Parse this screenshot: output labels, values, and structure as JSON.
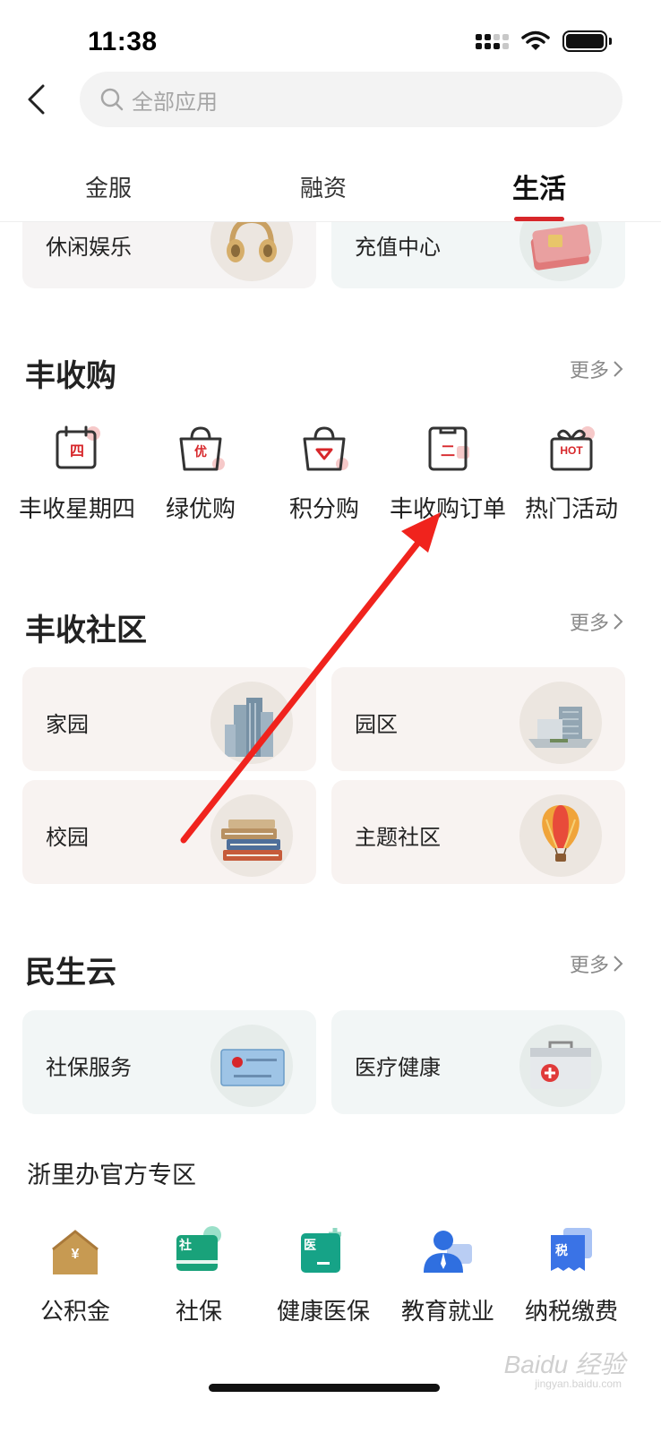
{
  "status_bar": {
    "time": "11:38"
  },
  "search": {
    "placeholder": "全部应用"
  },
  "tabs": [
    {
      "label": "金服",
      "active": false
    },
    {
      "label": "融资",
      "active": false
    },
    {
      "label": "生活",
      "active": true
    }
  ],
  "top_cards": [
    {
      "label": "休闲娱乐",
      "icon": "headphones-icon"
    },
    {
      "label": "充值中心",
      "icon": "sim-card-icon"
    }
  ],
  "fengshougou": {
    "title": "丰收购",
    "more": "更多",
    "items": [
      {
        "label": "丰收星期四",
        "icon": "calendar-icon",
        "glyph": "四"
      },
      {
        "label": "绿优购",
        "icon": "shopping-bag-icon",
        "glyph": "优"
      },
      {
        "label": "积分购",
        "icon": "heart-bag-icon"
      },
      {
        "label": "丰收购订单",
        "icon": "order-clipboard-icon",
        "glyph": "二"
      },
      {
        "label": "热门活动",
        "icon": "gift-icon",
        "glyph": "HOT"
      }
    ]
  },
  "community": {
    "title": "丰收社区",
    "more": "更多",
    "cards": [
      {
        "label": "家园",
        "icon": "buildings-icon"
      },
      {
        "label": "园区",
        "icon": "campus-building-icon"
      },
      {
        "label": "校园",
        "icon": "books-icon"
      },
      {
        "label": "主题社区",
        "icon": "hot-air-balloon-icon"
      }
    ]
  },
  "minsheng": {
    "title": "民生云",
    "more": "更多",
    "cards": [
      {
        "label": "社保服务",
        "icon": "social-security-card-icon"
      },
      {
        "label": "医疗健康",
        "icon": "first-aid-kit-icon"
      }
    ]
  },
  "zheliban": {
    "title": "浙里办官方专区",
    "items": [
      {
        "label": "公积金",
        "icon": "housing-fund-icon",
        "glyph": "¥"
      },
      {
        "label": "社保",
        "icon": "social-insurance-icon",
        "glyph": "社"
      },
      {
        "label": "健康医保",
        "icon": "medical-insurance-icon",
        "glyph": "医"
      },
      {
        "label": "教育就业",
        "icon": "education-employment-icon"
      },
      {
        "label": "纳税缴费",
        "icon": "tax-payment-icon",
        "glyph": "税"
      }
    ]
  },
  "watermark": {
    "brand": "Baidu 经验",
    "url": "jingyan.baidu.com"
  },
  "colors": {
    "accent": "#d7262a",
    "arrow": "#f0231d"
  }
}
